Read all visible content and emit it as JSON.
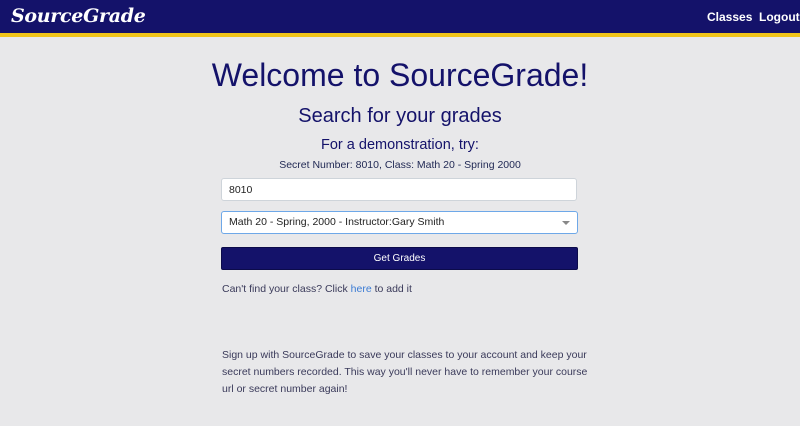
{
  "nav": {
    "brand": "SourceGrade",
    "classes_label": "Classes",
    "logout_label": "Logout"
  },
  "main": {
    "title": "Welcome to SourceGrade!",
    "subtitle": "Search for your grades",
    "demo_heading": "For a demonstration, try:",
    "demo_info": "Secret Number: 8010, Class: Math 20 - Spring 2000",
    "secret_number_value": "8010",
    "class_select_value": "Math 20 - Spring, 2000 - Instructor:Gary Smith",
    "get_grades_label": "Get Grades",
    "cant_find_prefix": "Can't find your class? Click ",
    "cant_find_link": "here",
    "cant_find_suffix": " to add it",
    "signup_text": "Sign up with SourceGrade to save your classes to your account and keep your secret numbers recorded. This way you'll never have to remember your course url or secret number again!"
  },
  "colors": {
    "navbar": "#14126a",
    "navbar_accent": "#f0c419",
    "background": "#e8e8ea",
    "link": "#3b7bd4"
  }
}
